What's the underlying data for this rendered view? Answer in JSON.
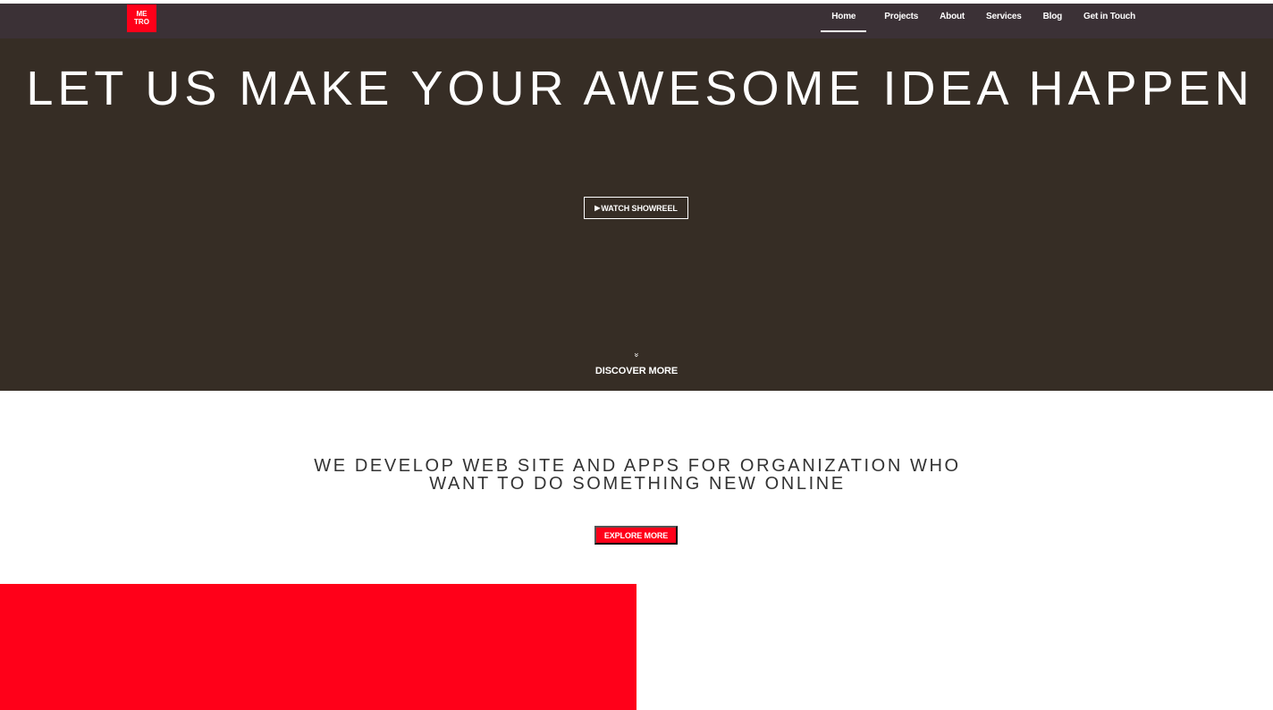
{
  "brand": {
    "logo_line1": "ME",
    "logo_line2": "TRO",
    "accent_color": "#ff0019"
  },
  "nav": {
    "items": [
      {
        "label": "Home",
        "active": true
      },
      {
        "label": "Projects",
        "active": false
      },
      {
        "label": "About",
        "active": false
      },
      {
        "label": "Services",
        "active": false
      },
      {
        "label": "Blog",
        "active": false
      },
      {
        "label": "Get in Touch",
        "active": false
      }
    ]
  },
  "hero": {
    "title": "LET US MAKE YOUR AWESOME IDEA HAPPEN",
    "watch_icon": "play-icon",
    "watch_label": "WATCH SHOWREEL",
    "discover_icon": "double-chevron-down-icon",
    "discover_label": "DISCOVER MORE",
    "background_color": "#362d25"
  },
  "intro": {
    "line1": "WE DEVELOP WEB SITE AND APPS FOR ORGANIZATION WHO",
    "line2": "WANT TO DO SOMETHING NEW ONLINE",
    "button_label": "EXPLORE MORE"
  }
}
